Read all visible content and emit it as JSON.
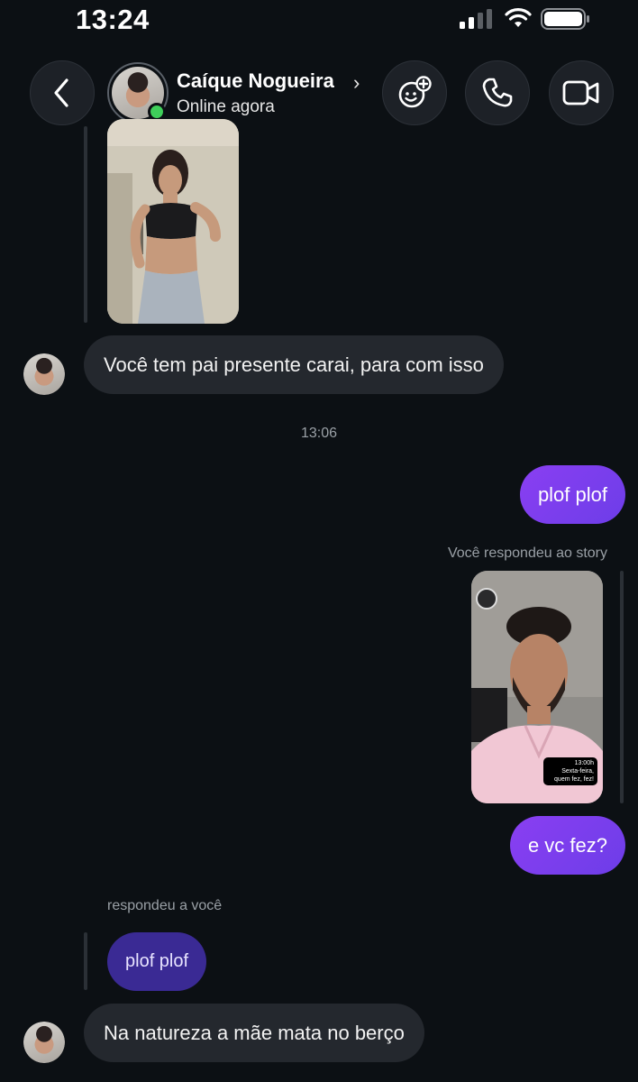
{
  "status_bar": {
    "time": "13:24"
  },
  "header": {
    "contact_name": "Caíque Nogueira",
    "contact_status": "Online agora"
  },
  "messages": {
    "incoming_1": "Você tem pai presente carai, para com isso",
    "timestamp_1": "13:06",
    "outgoing_1": "plof plof",
    "story_reply_label": "Você respondeu ao story",
    "story_caption_time": "13:00h",
    "story_caption_text": "Sexta-feira, quem fez, fez!",
    "outgoing_2": "e vc fez?",
    "reply_label": "respondeu a você",
    "quoted_reply": "plof plof",
    "incoming_2": "Na natureza a mãe mata no berço"
  },
  "icons": {
    "back": "chevron-left-icon",
    "effects": "face-sparkle-icon",
    "call": "phone-icon",
    "video": "video-camera-icon"
  },
  "colors": {
    "background": "#0c1014",
    "incoming_bubble": "#24282e",
    "outgoing_bubble": "#7b3ff0",
    "quoted_bubble": "#3a2a94",
    "online": "#3fcf5a"
  }
}
